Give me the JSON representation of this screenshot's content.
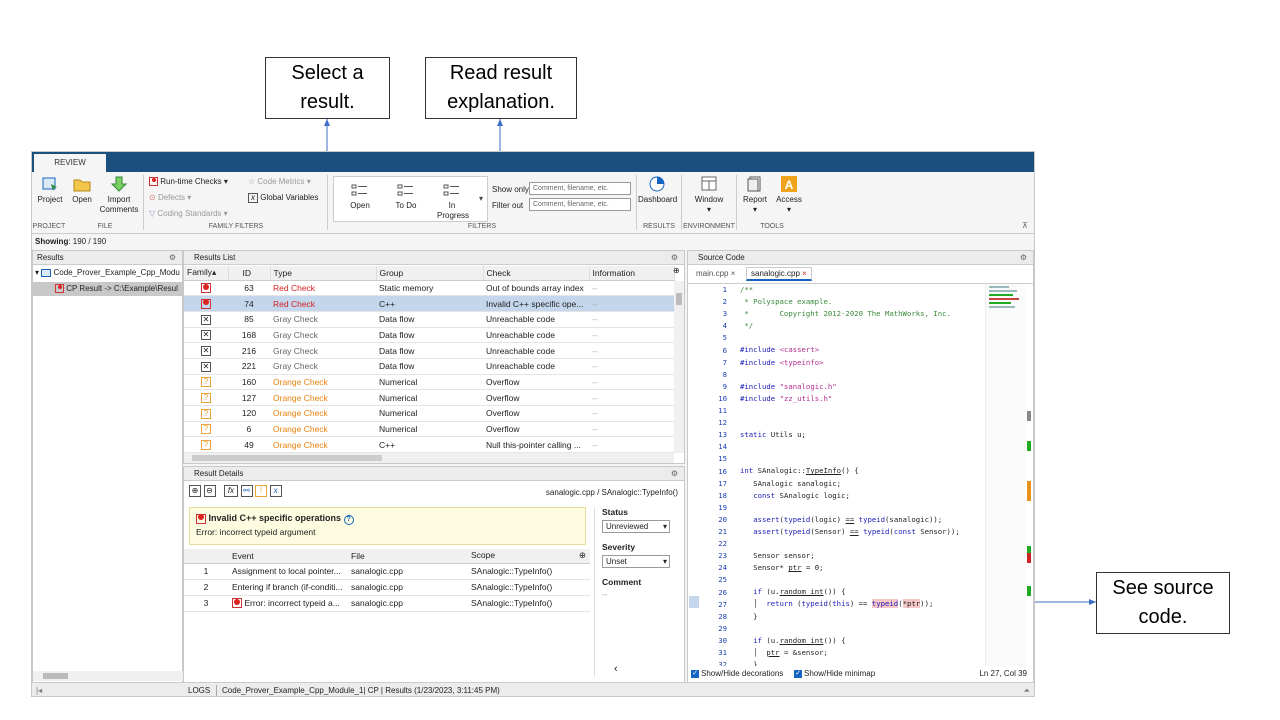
{
  "callouts": {
    "select": "Select a result.",
    "read": "Read result explanation.",
    "see": "See source code."
  },
  "tabs": {
    "review": "REVIEW"
  },
  "toolbar": {
    "project": "Project",
    "open": "Open",
    "import_comments": "Import Comments",
    "runtime_checks": "Run-time Checks",
    "defects": "Defects",
    "coding_standards": "Coding Standards",
    "code_metrics": "Code Metrics",
    "global_variables": "Global Variables",
    "filter_open": "Open",
    "filter_todo": "To Do",
    "filter_inprogress": "In Progress",
    "show_only": "Show only",
    "filter_out": "Filter out",
    "show_only_placeholder": "Comment, filename, etc.",
    "filter_out_placeholder": "Comment, filename, etc.",
    "dashboard": "Dashboard",
    "window": "Window",
    "report": "Report",
    "access": "Access",
    "sections": {
      "project": "PROJECT",
      "file": "FILE",
      "family_filters": "FAMILY FILTERS",
      "filters": "FILTERS",
      "results": "RESULTS",
      "environment": "ENVIRONMENT",
      "tools": "TOOLS"
    }
  },
  "showing": {
    "label": "Showing",
    "value": ": 190 / 190"
  },
  "results_tree": {
    "title": "Results",
    "module": "Code_Prover_Example_Cpp_Modu",
    "cp_result": "CP Result -> C:\\Example\\Resul"
  },
  "results_list": {
    "title": "Results List",
    "columns": [
      "Family",
      "ID",
      "Type",
      "Group",
      "Check",
      "Information"
    ],
    "rows": [
      {
        "icon": "red",
        "id": "63",
        "type": "Red Check",
        "cls": "red",
        "group": "Static memory",
        "check": "Out of bounds array index",
        "info": "--"
      },
      {
        "icon": "red",
        "id": "74",
        "type": "Red Check",
        "cls": "red",
        "group": "C++",
        "check": "Invalid C++ specific ope...",
        "info": "--",
        "selected": true
      },
      {
        "icon": "gray",
        "id": "85",
        "type": "Gray Check",
        "cls": "gray",
        "group": "Data flow",
        "check": "Unreachable code",
        "info": "--"
      },
      {
        "icon": "gray",
        "id": "168",
        "type": "Gray Check",
        "cls": "gray",
        "group": "Data flow",
        "check": "Unreachable code",
        "info": "--"
      },
      {
        "icon": "gray",
        "id": "216",
        "type": "Gray Check",
        "cls": "gray",
        "group": "Data flow",
        "check": "Unreachable code",
        "info": "--"
      },
      {
        "icon": "gray",
        "id": "221",
        "type": "Gray Check",
        "cls": "gray",
        "group": "Data flow",
        "check": "Unreachable code",
        "info": "--"
      },
      {
        "icon": "orange",
        "id": "160",
        "type": "Orange Check",
        "cls": "orange",
        "group": "Numerical",
        "check": "Overflow",
        "info": "--"
      },
      {
        "icon": "orange",
        "id": "127",
        "type": "Orange Check",
        "cls": "orange",
        "group": "Numerical",
        "check": "Overflow",
        "info": "--"
      },
      {
        "icon": "orange",
        "id": "120",
        "type": "Orange Check",
        "cls": "orange",
        "group": "Numerical",
        "check": "Overflow",
        "info": "--"
      },
      {
        "icon": "orange",
        "id": "6",
        "type": "Orange Check",
        "cls": "orange",
        "group": "Numerical",
        "check": "Overflow",
        "info": "--"
      },
      {
        "icon": "orange",
        "id": "49",
        "type": "Orange Check",
        "cls": "orange",
        "group": "C++",
        "check": "Null this-pointer calling ...",
        "info": "--"
      }
    ]
  },
  "result_details": {
    "title": "Result Details",
    "path": "sanalogic.cpp / SAnalogic::TypeInfo()",
    "check_title": "Invalid C++ specific operations",
    "error": "Error: incorrect typeid argument",
    "status_label": "Status",
    "status_value": "Unreviewed",
    "severity_label": "Severity",
    "severity_value": "Unset",
    "comment_label": "Comment",
    "comment_value": "--",
    "event_columns": [
      "",
      "Event",
      "File",
      "Scope"
    ],
    "events": [
      {
        "n": "1",
        "event": "Assignment to local pointer...",
        "file": "sanalogic.cpp",
        "scope": "SAnalogic::TypeInfo()"
      },
      {
        "n": "2",
        "event": "Entering if branch (if-conditi...",
        "file": "sanalogic.cpp",
        "scope": "SAnalogic::TypeInfo()"
      },
      {
        "n": "3",
        "event": "Error: incorrect typeid a...",
        "file": "sanalogic.cpp",
        "scope": "SAnalogic::TypeInfo()"
      }
    ]
  },
  "source": {
    "title": "Source Code",
    "tabs": [
      "main.cpp",
      "sanalogic.cpp"
    ],
    "cursor": "Ln 27, Col 39",
    "show_decorations": "Show/Hide decorations",
    "show_minimap": "Show/Hide minimap"
  },
  "status_bar": {
    "logs": "LOGS",
    "text": "Code_Prover_Example_Cpp_Module_1| CP | Results (1/23/2023, 3:11:45 PM)"
  },
  "colors": {
    "accent": "#1a4f7e",
    "selected_row": "#c3d6eb",
    "red": "#d62020",
    "orange": "#e8820c"
  }
}
